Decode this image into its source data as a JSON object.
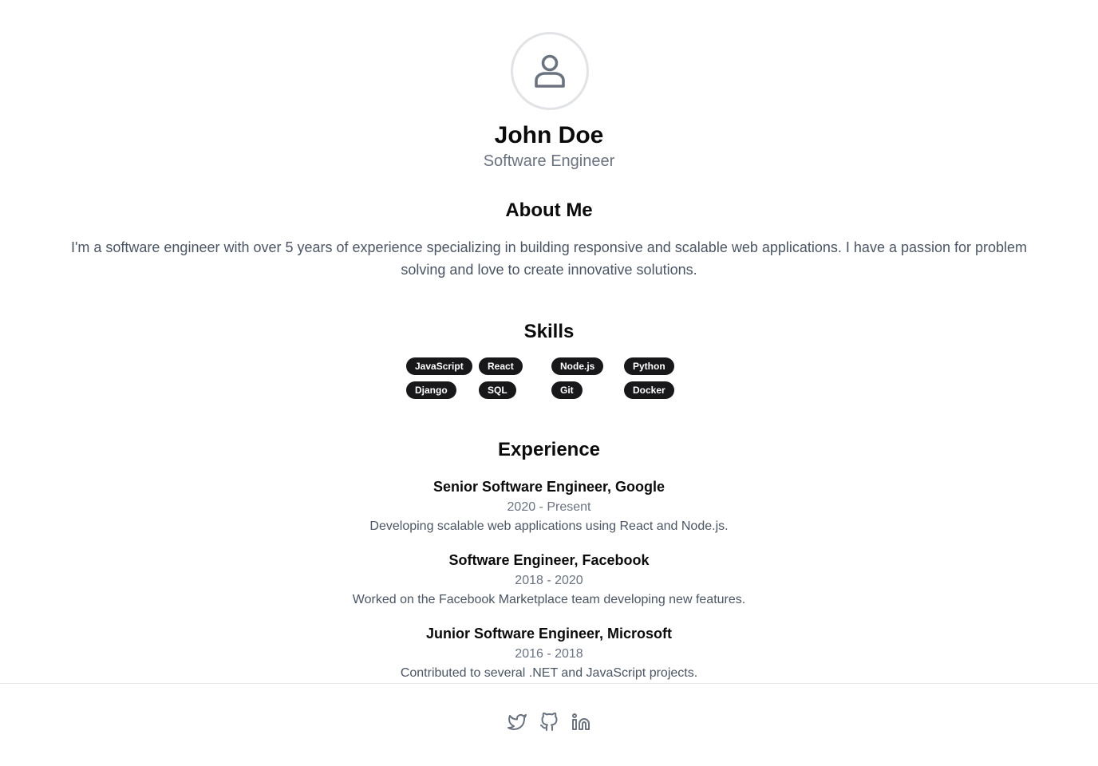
{
  "profile": {
    "name": "John Doe",
    "role": "Software Engineer",
    "avatar_icon": "user-icon"
  },
  "about": {
    "heading": "About Me",
    "text": "I'm a software engineer with over 5 years of experience specializing in building responsive and scalable web applications. I have a passion for problem solving and love to create innovative solutions."
  },
  "skills": {
    "heading": "Skills",
    "items": [
      "JavaScript",
      "React",
      "Node.js",
      "Python",
      "Django",
      "SQL",
      "Git",
      "Docker"
    ]
  },
  "experience": {
    "heading": "Experience",
    "jobs": [
      {
        "title": "Senior Software Engineer, Google",
        "dates": "2020 - Present",
        "description": "Developing scalable web applications using React and Node.js."
      },
      {
        "title": "Software Engineer, Facebook",
        "dates": "2018 - 2020",
        "description": "Worked on the Facebook Marketplace team developing new features."
      },
      {
        "title": "Junior Software Engineer, Microsoft",
        "dates": "2016 - 2018",
        "description": "Contributed to several .NET and JavaScript projects."
      }
    ]
  },
  "footer": {
    "social": [
      {
        "icon": "twitter-icon"
      },
      {
        "icon": "github-icon"
      },
      {
        "icon": "linkedin-icon"
      }
    ]
  },
  "colors": {
    "badge_bg": "#18181b",
    "muted_text": "#6b7280",
    "body_text": "#4b5563",
    "icon": "#6b7280"
  }
}
